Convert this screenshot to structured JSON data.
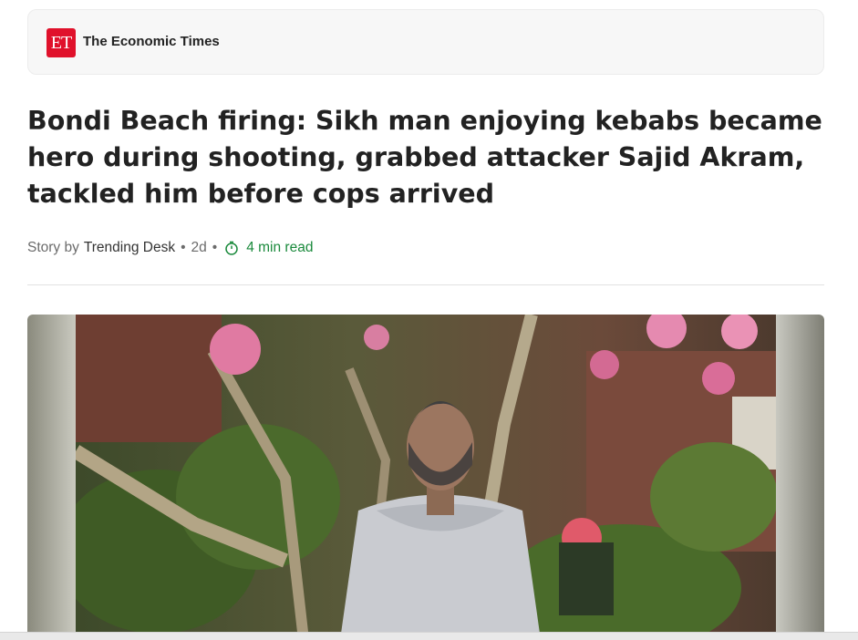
{
  "publisher": {
    "logo_text": "ET",
    "name": "The Economic Times",
    "brand_color": "#e0112b"
  },
  "article": {
    "headline": "Bondi Beach firing: Sikh man enjoying kebabs became hero during shooting, grabbed attacker Sajid Akram, tackled him before cops arrived",
    "byline": {
      "prefix": "Story by",
      "author": "Trending Desk",
      "age": "2d",
      "separator": "•",
      "read_time": "4 min read",
      "timer_icon": "stopwatch-icon",
      "read_time_color": "#1a8a3c"
    },
    "hero_image": {
      "subject": "man in grey hoodie seated in front of flowering tree and brick house"
    }
  }
}
